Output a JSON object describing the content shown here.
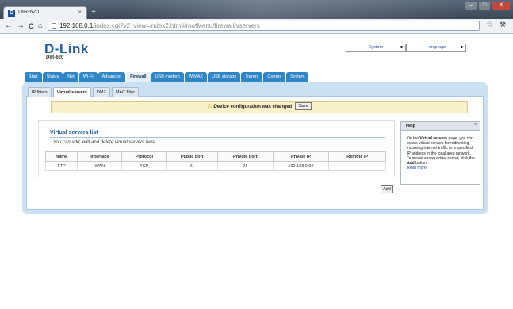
{
  "browser": {
    "tab_title": "DIR-620",
    "tab_close": "×",
    "new_tab": "+",
    "nav": {
      "back": "←",
      "forward": "→",
      "reload": "C",
      "home": "⌂"
    },
    "url_host": "192.168.0.1",
    "url_rest": "/index.cgi?v2_view=index2.html#rootMenu/firewall/vservers",
    "star": "☆",
    "wrench": "🔧"
  },
  "brand": {
    "logo": "D-Link",
    "model": "DIR-620"
  },
  "top_selects": {
    "system": "System",
    "language": "Language"
  },
  "nav_tabs": [
    {
      "label": "Start"
    },
    {
      "label": "Status"
    },
    {
      "label": "Net"
    },
    {
      "label": "Wi-Fi"
    },
    {
      "label": "Advanced"
    },
    {
      "label": "Firewall",
      "active": true
    },
    {
      "label": "USB modem"
    },
    {
      "label": "WiMAX"
    },
    {
      "label": "USB storage"
    },
    {
      "label": "Torrent"
    },
    {
      "label": "Control"
    },
    {
      "label": "System"
    }
  ],
  "sub_tabs": [
    {
      "label": "IP filters"
    },
    {
      "label": "Virtual servers",
      "active": true
    },
    {
      "label": "DMZ"
    },
    {
      "label": "MAC filter"
    }
  ],
  "notice": {
    "icon": "warning-icon",
    "text": "Device configuration was changed",
    "save_label": "Save"
  },
  "virtual_servers": {
    "title": "Virtual servers list",
    "description": "You can add, edit and delete virtual servers here",
    "columns": [
      "Name",
      "Interface",
      "Protocol",
      "Public port",
      "Private port",
      "Private IP",
      "Remote IP"
    ],
    "rows": [
      [
        "FTP",
        "WAN",
        "TCP",
        "21",
        "21",
        "192.168.0.92",
        ""
      ]
    ],
    "add_label": "Add"
  },
  "help": {
    "title": "Help",
    "close": "×",
    "p1_pre": "On the ",
    "p1_bold": "Virtual servers",
    "p1_post": " page, you can create virtual servers for redirecting incoming Internet traffic to a specified IP address in the local area network.",
    "p2_pre": "To create a new virtual server, click the ",
    "p2_bold": "Add",
    "p2_post": " button.",
    "more": "Read more"
  },
  "colors": {
    "accent_blue": "#2f86c6",
    "logo_blue": "#1c5ca8",
    "panel_bg": "#c9e1f2",
    "notice_bg": "#fbf1c8"
  }
}
